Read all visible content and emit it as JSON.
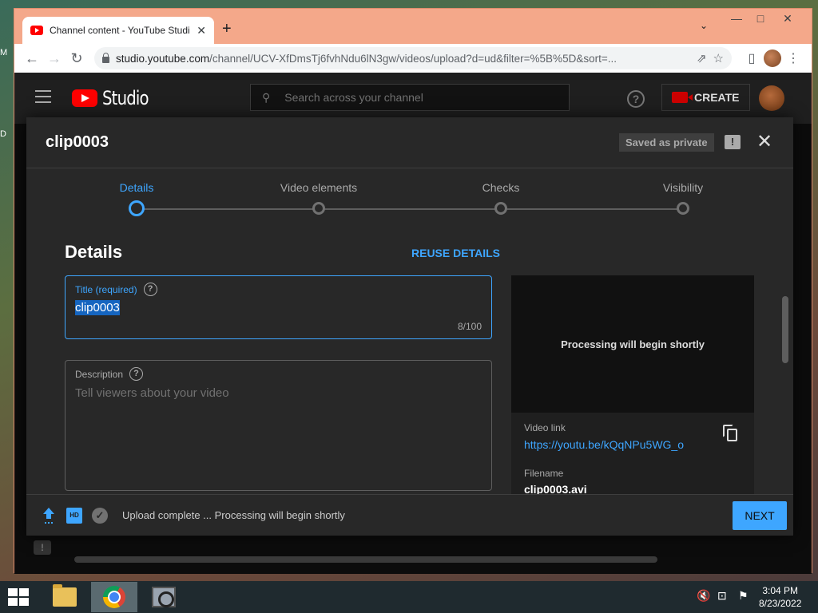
{
  "browser": {
    "tab_title": "Channel content - YouTube Studi",
    "url_host": "studio.youtube.com",
    "url_rest": "/channel/UCV-XfDmsTj6fvhNdu6lN3gw/videos/upload?d=ud&filter=%5B%5D&sort=..."
  },
  "studio": {
    "logo_text": "Studio",
    "search_placeholder": "Search across your channel",
    "create_label": "CREATE"
  },
  "dialog": {
    "title": "clip0003",
    "saved_badge": "Saved as private",
    "steps": [
      {
        "label": "Details",
        "active": true
      },
      {
        "label": "Video elements",
        "active": false
      },
      {
        "label": "Checks",
        "active": false
      },
      {
        "label": "Visibility",
        "active": false
      }
    ],
    "section_title": "Details",
    "reuse_label": "REUSE DETAILS",
    "title_field": {
      "label": "Title (required)",
      "value": "clip0003",
      "counter": "8/100"
    },
    "description_field": {
      "label": "Description",
      "placeholder": "Tell viewers about your video"
    },
    "preview": {
      "processing_text": "Processing will begin shortly",
      "video_link_label": "Video link",
      "video_link": "https://youtu.be/kQqNPu5WG_o",
      "filename_label": "Filename",
      "filename": "clip0003.avi"
    },
    "footer": {
      "status": "Upload complete ... Processing will begin shortly",
      "next_label": "NEXT",
      "hd_text": "HD"
    }
  },
  "taskbar": {
    "time": "3:04 PM",
    "date": "8/23/2022"
  },
  "colors": {
    "accent": "#3ea6ff",
    "brand_red": "#ff0000",
    "dialog_bg": "#282828"
  }
}
